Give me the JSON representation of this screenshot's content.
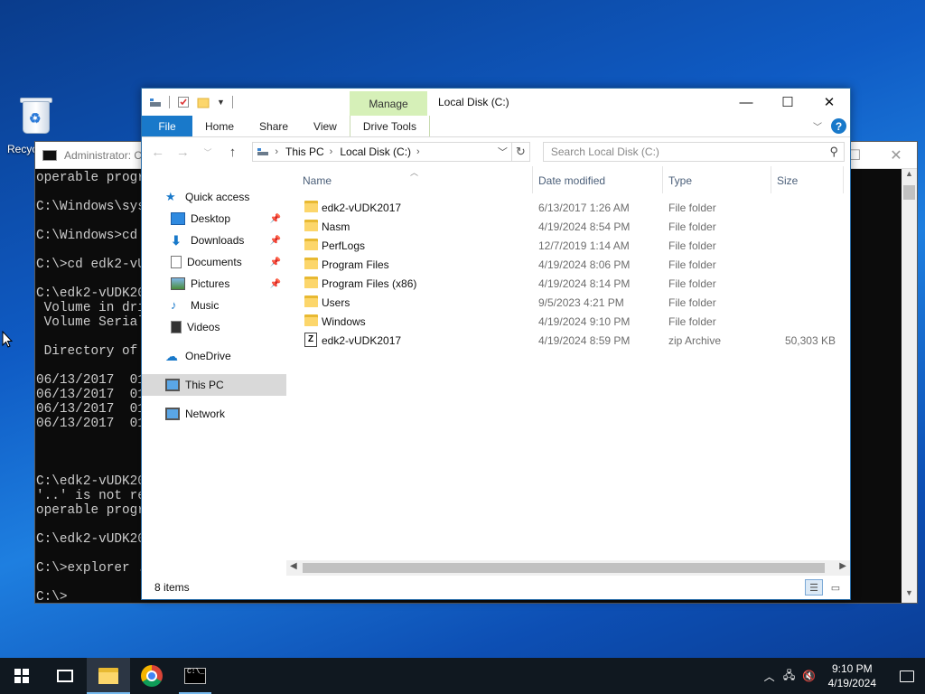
{
  "desktop": {
    "recycle_bin_label": "Recyc"
  },
  "cmd": {
    "title": "Administrator: C",
    "lines": "operable progra\n\nC:\\Windows\\syst\n\nC:\\Windows>cd .\n\nC:\\>cd edk2-vUD\n\nC:\\edk2-vUDK201\n Volume in driv\n Volume Serial \n\n Directory of C\n\n06/13/2017  01:\n06/13/2017  01:\n06/13/2017  01:\n06/13/2017  01:\n\n\n\nC:\\edk2-vUDK201\n'..' is not rec\noperable progra\n\nC:\\edk2-vUDK201\n\nC:\\>explorer .\n\nC:\\>"
  },
  "explorer": {
    "window_title": "Local Disk (C:)",
    "manage_tab": "Manage",
    "tabs": {
      "file": "File",
      "home": "Home",
      "share": "Share",
      "view": "View",
      "drive_tools": "Drive Tools"
    },
    "address": {
      "segments": [
        "This PC",
        "Local Disk (C:)"
      ]
    },
    "search": {
      "placeholder": "Search Local Disk (C:)"
    },
    "nav": {
      "quick_access": "Quick access",
      "desktop": "Desktop",
      "downloads": "Downloads",
      "documents": "Documents",
      "pictures": "Pictures",
      "music": "Music",
      "videos": "Videos",
      "onedrive": "OneDrive",
      "this_pc": "This PC",
      "network": "Network"
    },
    "columns": {
      "name": "Name",
      "date": "Date modified",
      "type": "Type",
      "size": "Size"
    },
    "files": [
      {
        "name": "edk2-vUDK2017",
        "date": "6/13/2017 1:26 AM",
        "type": "File folder",
        "size": "",
        "kind": "folder"
      },
      {
        "name": "Nasm",
        "date": "4/19/2024 8:54 PM",
        "type": "File folder",
        "size": "",
        "kind": "folder"
      },
      {
        "name": "PerfLogs",
        "date": "12/7/2019 1:14 AM",
        "type": "File folder",
        "size": "",
        "kind": "folder"
      },
      {
        "name": "Program Files",
        "date": "4/19/2024 8:06 PM",
        "type": "File folder",
        "size": "",
        "kind": "folder"
      },
      {
        "name": "Program Files (x86)",
        "date": "4/19/2024 8:14 PM",
        "type": "File folder",
        "size": "",
        "kind": "folder"
      },
      {
        "name": "Users",
        "date": "9/5/2023 4:21 PM",
        "type": "File folder",
        "size": "",
        "kind": "folder"
      },
      {
        "name": "Windows",
        "date": "4/19/2024 9:10 PM",
        "type": "File folder",
        "size": "",
        "kind": "folder"
      },
      {
        "name": "edk2-vUDK2017",
        "date": "4/19/2024 8:59 PM",
        "type": "zip Archive",
        "size": "50,303 KB",
        "kind": "zip"
      }
    ],
    "status": "8 items"
  },
  "taskbar": {
    "time": "9:10 PM",
    "date": "4/19/2024"
  },
  "colors": {
    "accent": "#1979ca",
    "manage_tab": "#d6f0b8",
    "folder": "#fcd66b"
  }
}
